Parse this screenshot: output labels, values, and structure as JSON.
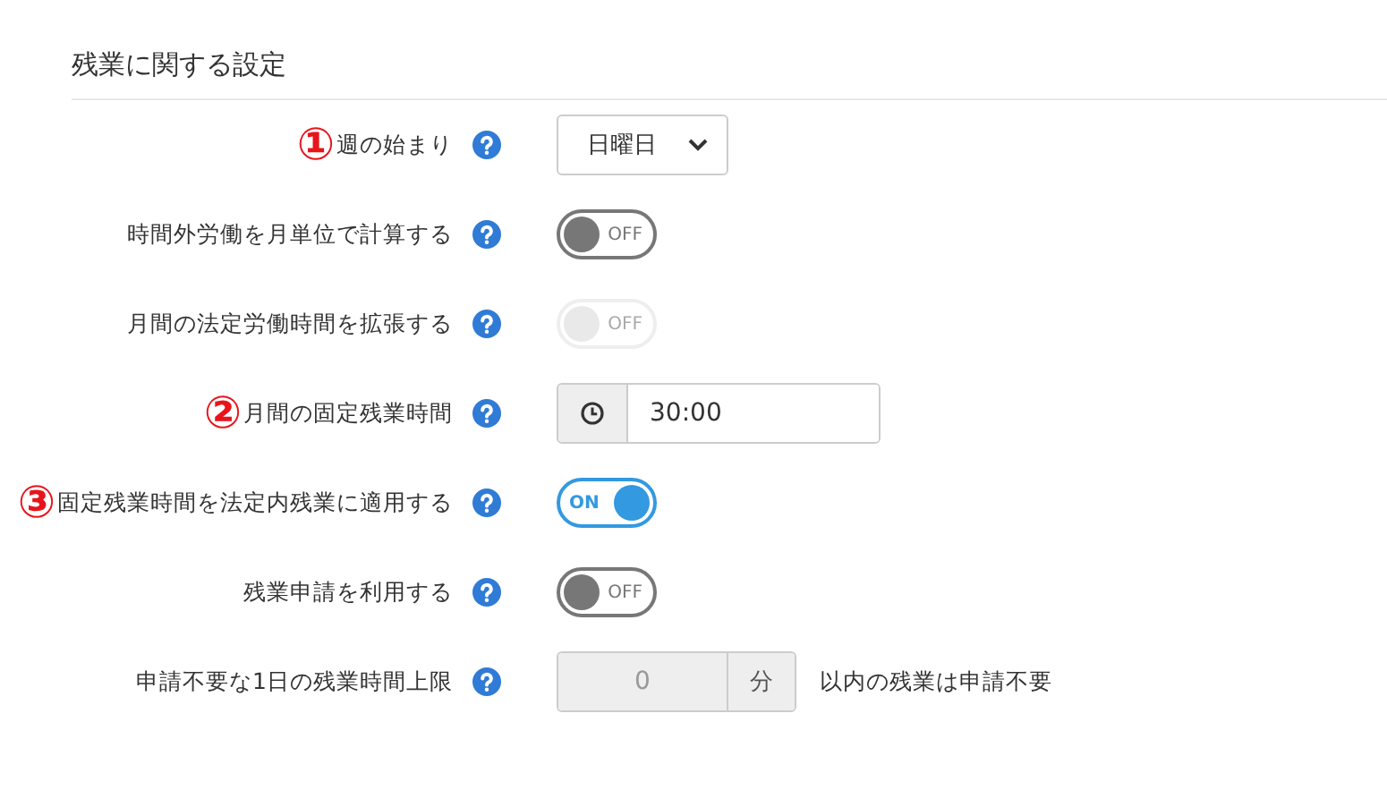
{
  "section": {
    "title": "残業に関する設定"
  },
  "rows": [
    {
      "kind": "select",
      "marker": "①",
      "label": "週の始まり",
      "value": "日曜日"
    },
    {
      "kind": "toggle",
      "label": "時間外労働を月単位で計算する",
      "on": false,
      "disabled": false,
      "state_text": "OFF"
    },
    {
      "kind": "toggle",
      "label": "月間の法定労働時間を拡張する",
      "on": false,
      "disabled": true,
      "state_text": "OFF"
    },
    {
      "kind": "time",
      "marker": "②",
      "label": "月間の固定残業時間",
      "value": "30:00"
    },
    {
      "kind": "toggle",
      "marker": "③",
      "label": "固定残業時間を法定内残業に適用する",
      "on": true,
      "disabled": false,
      "state_text": "ON"
    },
    {
      "kind": "toggle",
      "label": "残業申請を利用する",
      "on": false,
      "disabled": false,
      "state_text": "OFF"
    },
    {
      "kind": "number",
      "label": "申請不要な1日の残業時間上限",
      "value": "0",
      "unit": "分",
      "suffix": "以内の残業は申請不要",
      "disabled": true
    }
  ]
}
